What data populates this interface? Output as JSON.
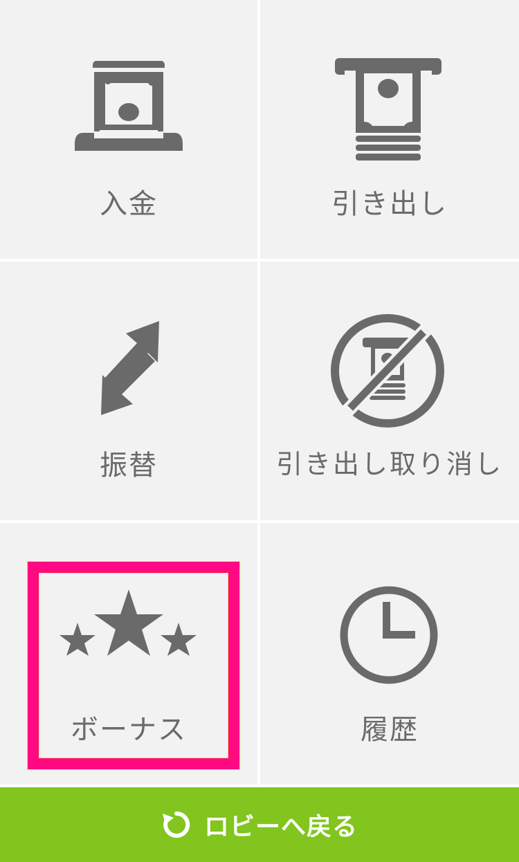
{
  "menu": {
    "deposit_label": "入金",
    "withdraw_label": "引き出し",
    "transfer_label": "振替",
    "cancel_withdraw_label": "引き出し取り消し",
    "bonus_label": "ボーナス",
    "history_label": "履歴"
  },
  "footer": {
    "back_to_lobby_label": "ロビーへ戻る"
  },
  "icons": {
    "deposit": "cash-insert-icon",
    "withdraw": "cash-withdraw-icon",
    "transfer": "transfer-arrows-icon",
    "cancel_withdraw": "cancel-withdraw-icon",
    "bonus": "stars-icon",
    "history": "clock-icon",
    "lobby": "refresh-icon"
  },
  "colors": {
    "tile_background": "#f2f2f2",
    "icon_gray": "#6a6a6a",
    "highlight": "#ff0a82",
    "button_green": "#82c51e"
  }
}
